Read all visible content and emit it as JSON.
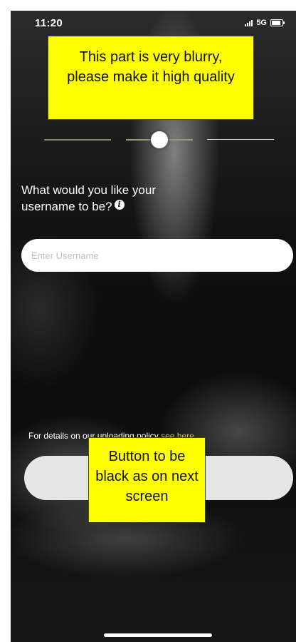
{
  "status_bar": {
    "time": "11:20",
    "network": "5G",
    "signal_icon": "signal-bars-icon",
    "battery_icon": "battery-icon"
  },
  "annotations": {
    "top_note": "This part is very blurry, please make it high quality",
    "button_note": "Button to be black as on next screen",
    "note_color": "#ffff00"
  },
  "step_indicator": {
    "current_step": 2,
    "total_steps": 3
  },
  "form": {
    "question_line1": "What would you like your",
    "question_line2": "username to be?",
    "info_icon_glyph": "i",
    "username_placeholder": "Enter Username"
  },
  "policy": {
    "text": "For details on our uploading policy",
    "link_text": "see here",
    "link_color": "#d6b563"
  },
  "continue_button": {
    "label": ""
  }
}
